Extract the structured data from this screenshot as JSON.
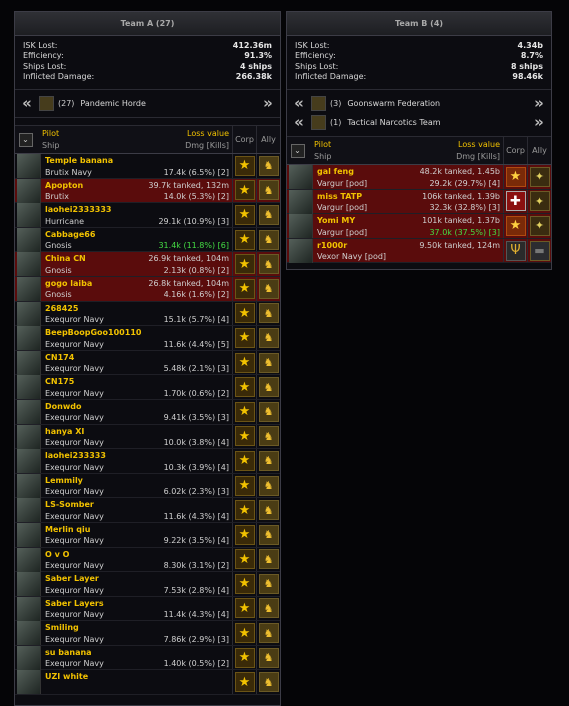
{
  "teamA": {
    "title": "Team A (27)",
    "stats": [
      {
        "label": "ISK Lost:",
        "value": "412.36m"
      },
      {
        "label": "Efficiency:",
        "value": "91.3%"
      },
      {
        "label": "Ships Lost:",
        "value": "4 ships"
      },
      {
        "label": "Inflicted Damage:",
        "value": "266.38k"
      }
    ],
    "alliances": [
      {
        "count": "(27)",
        "name": "Pandemic Horde",
        "icon": "horde-icon"
      }
    ],
    "header": {
      "pilot": "Pilot",
      "ship": "Ship",
      "loss_value": "Loss value",
      "dmg": "Dmg [Kills]",
      "corp": "Corp",
      "ally": "Ally"
    },
    "rows": [
      {
        "pilot": "Temple banana",
        "ship": "Brutix Navy",
        "loss": "",
        "dmg": "17.4k (6.5%) [2]",
        "lost": false,
        "hi": false
      },
      {
        "pilot": "Apopton",
        "ship": "Brutix",
        "loss": "39.7k tanked, 132m",
        "dmg": "14.0k (5.3%) [2]",
        "lost": true,
        "hi": false
      },
      {
        "pilot": "laohei2333333",
        "ship": "Hurricane",
        "loss": "",
        "dmg": "29.1k (10.9%) [3]",
        "lost": false,
        "hi": false
      },
      {
        "pilot": "Cabbage66",
        "ship": "Gnosis",
        "loss": "",
        "dmg": "31.4k (11.8%) [6]",
        "lost": false,
        "hi": true
      },
      {
        "pilot": "China CN",
        "ship": "Gnosis",
        "loss": "26.9k tanked, 104m",
        "dmg": "2.13k (0.8%) [2]",
        "lost": true,
        "hi": false
      },
      {
        "pilot": "gogo laiba",
        "ship": "Gnosis",
        "loss": "26.8k tanked, 104m",
        "dmg": "4.16k (1.6%) [2]",
        "lost": true,
        "hi": false
      },
      {
        "pilot": "268425",
        "ship": "Exequror Navy",
        "loss": "",
        "dmg": "15.1k (5.7%) [4]",
        "lost": false,
        "hi": false
      },
      {
        "pilot": "BeepBoopGoo100110",
        "ship": "Exequror Navy",
        "loss": "",
        "dmg": "11.6k (4.4%) [5]",
        "lost": false,
        "hi": false
      },
      {
        "pilot": "CN174",
        "ship": "Exequror Navy",
        "loss": "",
        "dmg": "5.48k (2.1%) [3]",
        "lost": false,
        "hi": false
      },
      {
        "pilot": "CN175",
        "ship": "Exequror Navy",
        "loss": "",
        "dmg": "1.70k (0.6%) [2]",
        "lost": false,
        "hi": false
      },
      {
        "pilot": "Donwdo",
        "ship": "Exequror Navy",
        "loss": "",
        "dmg": "9.41k (3.5%) [3]",
        "lost": false,
        "hi": false
      },
      {
        "pilot": "hanya XI",
        "ship": "Exequror Navy",
        "loss": "",
        "dmg": "10.0k (3.8%) [4]",
        "lost": false,
        "hi": false
      },
      {
        "pilot": "laohei233333",
        "ship": "Exequror Navy",
        "loss": "",
        "dmg": "10.3k (3.9%) [4]",
        "lost": false,
        "hi": false
      },
      {
        "pilot": "Lemmily",
        "ship": "Exequror Navy",
        "loss": "",
        "dmg": "6.02k (2.3%) [3]",
        "lost": false,
        "hi": false
      },
      {
        "pilot": "LS-Somber",
        "ship": "Exequror Navy",
        "loss": "",
        "dmg": "11.6k (4.3%) [4]",
        "lost": false,
        "hi": false
      },
      {
        "pilot": "Merlin qiu",
        "ship": "Exequror Navy",
        "loss": "",
        "dmg": "9.22k (3.5%) [4]",
        "lost": false,
        "hi": false
      },
      {
        "pilot": "O v O",
        "ship": "Exequror Navy",
        "loss": "",
        "dmg": "8.30k (3.1%) [2]",
        "lost": false,
        "hi": false
      },
      {
        "pilot": "Saber Layer",
        "ship": "Exequror Navy",
        "loss": "",
        "dmg": "7.53k (2.8%) [4]",
        "lost": false,
        "hi": false
      },
      {
        "pilot": "Saber Layers",
        "ship": "Exequror Navy",
        "loss": "",
        "dmg": "11.4k (4.3%) [4]",
        "lost": false,
        "hi": false
      },
      {
        "pilot": "Smiling",
        "ship": "Exequror Navy",
        "loss": "",
        "dmg": "7.86k (2.9%) [3]",
        "lost": false,
        "hi": false
      },
      {
        "pilot": "su banana",
        "ship": "Exequror Navy",
        "loss": "",
        "dmg": "1.40k (0.5%) [2]",
        "lost": false,
        "hi": false
      },
      {
        "pilot": "UZI white",
        "ship": "",
        "loss": "",
        "dmg": "",
        "lost": false,
        "hi": false
      }
    ]
  },
  "teamB": {
    "title": "Team B (4)",
    "stats": [
      {
        "label": "ISK Lost:",
        "value": "4.34b"
      },
      {
        "label": "Efficiency:",
        "value": "8.7%"
      },
      {
        "label": "Ships Lost:",
        "value": "8 ships"
      },
      {
        "label": "Inflicted Damage:",
        "value": "98.46k"
      }
    ],
    "alliances": [
      {
        "count": "(3)",
        "name": "Goonswarm Federation",
        "icon": "goonswarm-icon"
      },
      {
        "count": "(1)",
        "name": "Tactical Narcotics Team",
        "icon": "tnt-icon"
      }
    ],
    "header": {
      "pilot": "Pilot",
      "ship": "Ship",
      "loss_value": "Loss value",
      "dmg": "Dmg [Kills]",
      "corp": "Corp",
      "ally": "Ally"
    },
    "rows": [
      {
        "pilot": "gal feng",
        "ship": "Vargur [pod]",
        "loss": "48.2k tanked, 1.45b",
        "dmg": "29.2k (29.7%) [4]",
        "lost": true,
        "hi": false,
        "corp": "red",
        "ally": "gs"
      },
      {
        "pilot": "miss TATP",
        "ship": "Vargur [pod]",
        "loss": "106k tanked, 1.39b",
        "dmg": "32.3k (32.8%) [3]",
        "lost": true,
        "hi": false,
        "corp": "white",
        "ally": "gs"
      },
      {
        "pilot": "Yomi MY",
        "ship": "Vargur [pod]",
        "loss": "101k tanked, 1.37b",
        "dmg": "37.0k (37.5%) [3]",
        "lost": true,
        "hi": true,
        "corp": "red",
        "ally": "gs"
      },
      {
        "pilot": "r1000r",
        "ship": "Vexor Navy [pod]",
        "loss": "9.50k tanked, 124m",
        "dmg": "",
        "lost": true,
        "hi": false,
        "corp": "tri",
        "ally": "tn"
      }
    ]
  },
  "chevron_left": "«",
  "chevron_right": "»",
  "toggle_glyph": "⌄"
}
